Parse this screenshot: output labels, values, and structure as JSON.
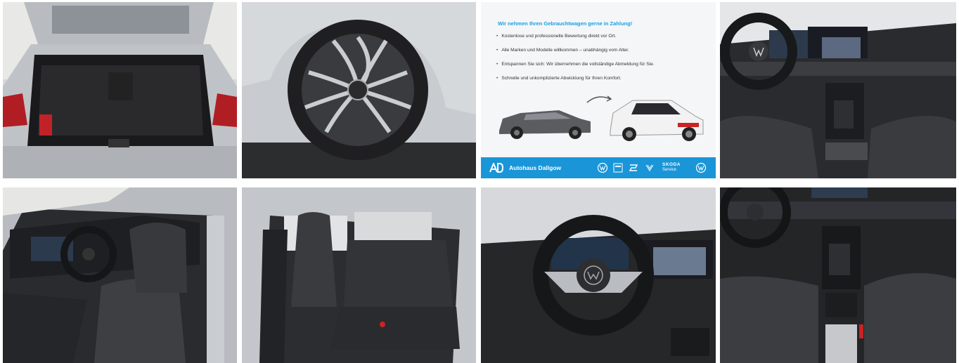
{
  "info_panel": {
    "title": "Wir nehmen Ihren Gebrauchtwagen gerne in Zahlung!",
    "bullets": [
      "Kostenlose und professionelle Bewertung direkt vor Ort.",
      "Alle Marken und Modelle willkommen – unabhängig vom Alter.",
      "Entspannen Sie sich: Wir übernehmen die vollständige Abmeldung für Sie.",
      "Schnelle und unkomplizierte Abwicklung für Ihren Komfort."
    ],
    "dealer_name": "Autohaus Dallgow",
    "partner_skoda": "SKODA",
    "partner_skoda_sub": "Service",
    "footer_color": "#1a96d8",
    "title_color": "#1aa0e0"
  },
  "gallery": {
    "tiles": [
      {
        "icon": "trunk-photo"
      },
      {
        "icon": "wheel-photo"
      },
      {
        "icon": "trade-in-banner"
      },
      {
        "icon": "dashboard-photo"
      },
      {
        "icon": "front-seats-photo"
      },
      {
        "icon": "rear-seats-photo"
      },
      {
        "icon": "steering-wheel-photo"
      },
      {
        "icon": "center-console-photo"
      }
    ]
  }
}
